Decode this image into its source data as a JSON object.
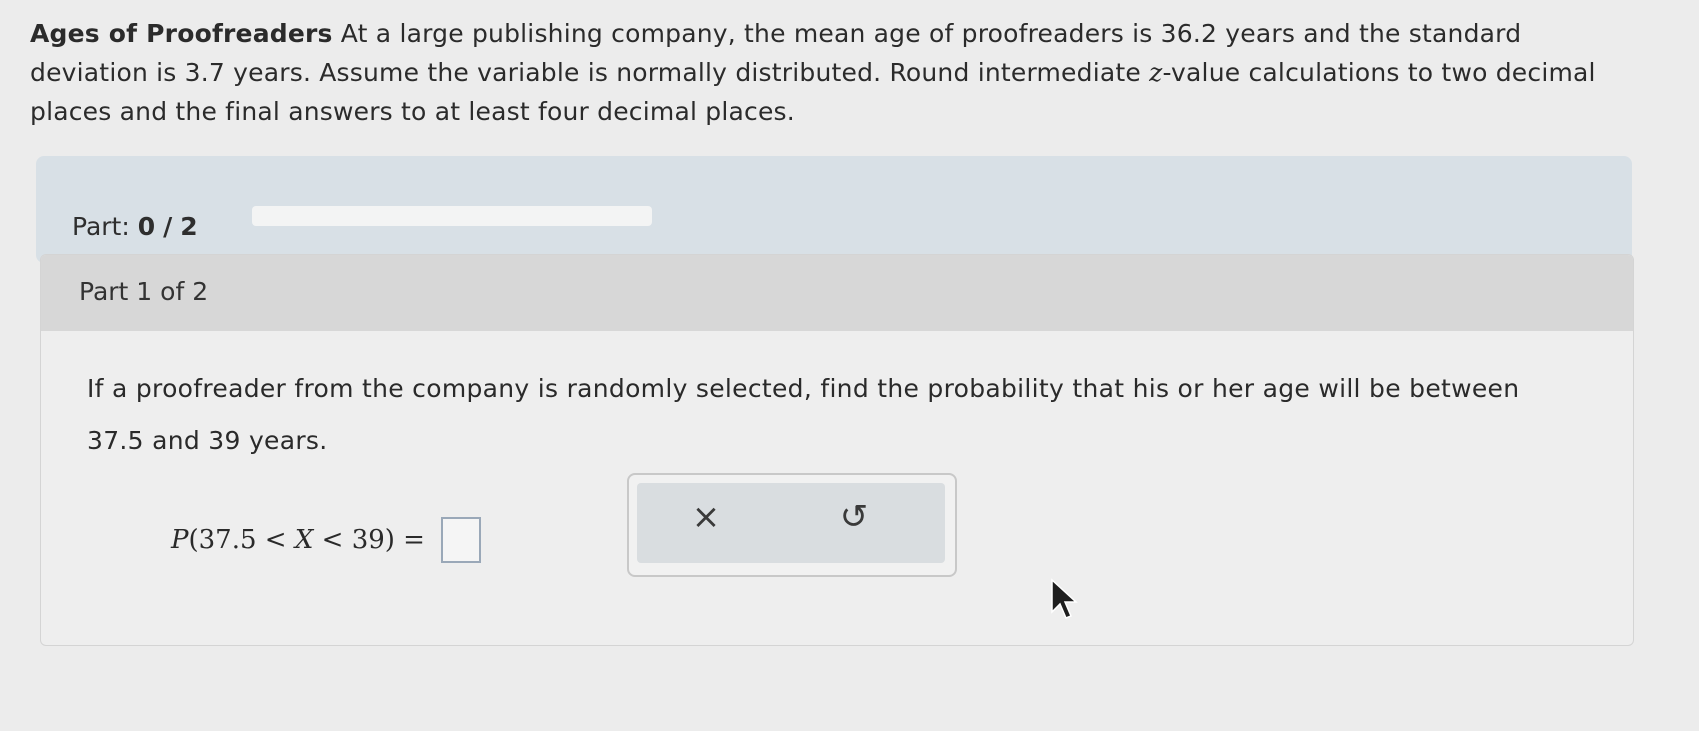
{
  "problem": {
    "title": "Ages of Proofreaders",
    "intro_part1": "At a large publishing company, the mean age of proofreaders is 36.2 years and the standard deviation is 3.7 years. Assume the variable is normally distributed. Round intermediate ",
    "z_symbol": "z",
    "intro_part2": "-value calculations to two decimal places and the final answers to at least four decimal places."
  },
  "progress": {
    "label": "Part:",
    "current": "0",
    "separator": "/",
    "total": "2",
    "fraction_complete": 0
  },
  "part": {
    "header": "Part 1 of 2",
    "question": "If a proofreader from the company is randomly selected, find the probability that his or her age will be between 37.5 and 39 years.",
    "equation": {
      "p": "P",
      "open": "(37.5 < ",
      "var": "X",
      "close": " < 39) ="
    },
    "answer_value": ""
  },
  "tools": {
    "clear_symbol": "×",
    "undo_symbol": "↺"
  }
}
